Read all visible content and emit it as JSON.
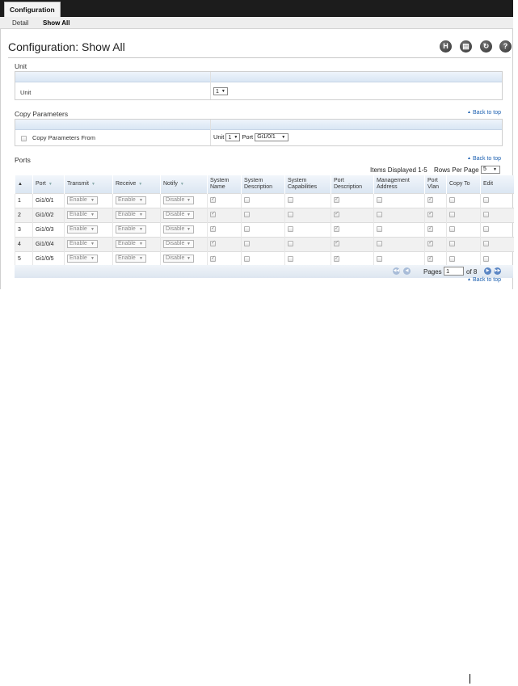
{
  "nav": {
    "active_tab": "Configuration",
    "subnav": [
      "Detail",
      "Show All"
    ]
  },
  "header": {
    "title": "Configuration: Show All",
    "icons": [
      "save-icon",
      "print-icon",
      "refresh-icon",
      "help-icon"
    ]
  },
  "unit_section": {
    "title": "Unit",
    "label": "Unit",
    "value": "1"
  },
  "copy_section": {
    "title": "Copy Parameters",
    "back_to_top": "Back to top",
    "label": "Copy Parameters From",
    "unit_label": "Unit",
    "unit_value": "1",
    "port_label": "Port",
    "port_value": "Gi1/0/1"
  },
  "ports_section": {
    "title": "Ports",
    "back_to_top": "Back to top",
    "items_displayed": "Items Displayed 1-5",
    "rows_per_page_label": "Rows Per Page",
    "rows_per_page": "5",
    "columns": [
      "",
      "Port",
      "Transmit",
      "Receive",
      "Notify",
      "System Name",
      "System Description",
      "System Capabilities",
      "Port Description",
      "Management Address",
      "Port Vlan",
      "Copy To",
      "Edit"
    ],
    "rows": [
      {
        "index": "1",
        "port": "Gi1/0/1",
        "transmit": "Enable",
        "receive": "Enable",
        "notify": "Disable",
        "checks": [
          true,
          false,
          false,
          true,
          false,
          true,
          false,
          false
        ]
      },
      {
        "index": "2",
        "port": "Gi1/0/2",
        "transmit": "Enable",
        "receive": "Enable",
        "notify": "Disable",
        "checks": [
          true,
          false,
          false,
          true,
          false,
          true,
          false,
          false
        ]
      },
      {
        "index": "3",
        "port": "Gi1/0/3",
        "transmit": "Enable",
        "receive": "Enable",
        "notify": "Disable",
        "checks": [
          true,
          false,
          false,
          true,
          false,
          true,
          false,
          false
        ]
      },
      {
        "index": "4",
        "port": "Gi1/0/4",
        "transmit": "Enable",
        "receive": "Enable",
        "notify": "Disable",
        "checks": [
          true,
          false,
          false,
          true,
          false,
          true,
          false,
          false
        ]
      },
      {
        "index": "5",
        "port": "Gi1/0/5",
        "transmit": "Enable",
        "receive": "Enable",
        "notify": "Disable",
        "checks": [
          true,
          false,
          false,
          true,
          false,
          true,
          false,
          false
        ]
      }
    ],
    "pages_label": "Pages",
    "page_value": "1",
    "of_pages": "of 8",
    "back_to_top_bottom": "Back to top"
  }
}
